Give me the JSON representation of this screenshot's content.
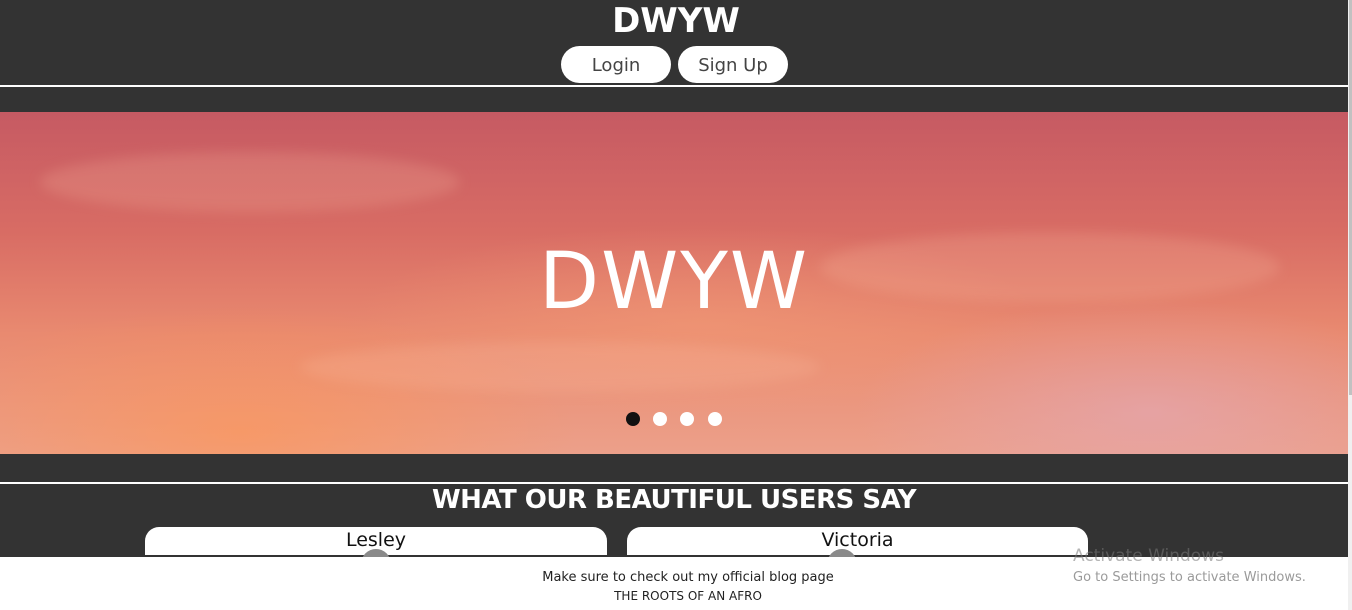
{
  "header": {
    "title": "DWYW",
    "login_label": "Login",
    "signup_label": "Sign Up"
  },
  "hero": {
    "title": "DWYW",
    "slides": 4,
    "active_slide": 1
  },
  "testimonials": {
    "heading": "WHAT OUR BEAUTIFUL USERS SAY",
    "cards": [
      {
        "name": "Lesley"
      },
      {
        "name": "Victoria"
      }
    ]
  },
  "footer": {
    "text": "Make sure to check out my official blog page",
    "link_label": "THE ROOTS OF AN AFRO"
  },
  "watermark": {
    "title": "Activate Windows",
    "subtitle": "Go to Settings to activate Windows."
  },
  "colors": {
    "background": "#333333",
    "header_text": "#ffffff",
    "button_bg": "#ffffff",
    "dot_active": "#111111",
    "dot_inactive": "#ffffff"
  }
}
